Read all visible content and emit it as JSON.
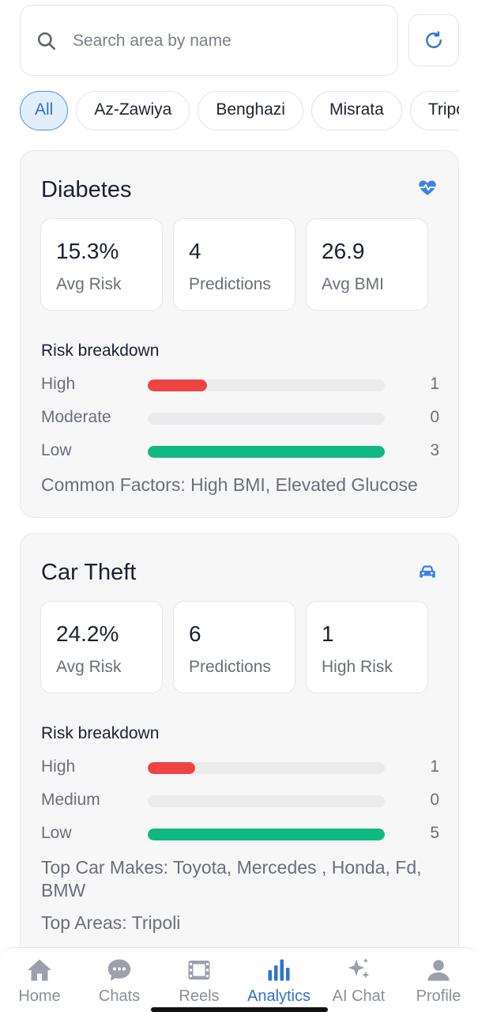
{
  "search": {
    "placeholder": "Search area by name",
    "value": ""
  },
  "chips": [
    "All",
    "Az-Zawiya",
    "Benghazi",
    "Misrata",
    "Tripoli"
  ],
  "cards": [
    {
      "title": "Diabetes",
      "icon": "heartbeat-icon",
      "stats": [
        {
          "value": "15.3%",
          "label": "Avg Risk"
        },
        {
          "value": "4",
          "label": "Predictions"
        },
        {
          "value": "26.9",
          "label": "Avg BMI"
        }
      ],
      "breakdown_label": "Risk breakdown",
      "breakdown": [
        {
          "name": "High",
          "count": "1",
          "fraction": 0.25,
          "color": "#ef4444"
        },
        {
          "name": "Moderate",
          "count": "0",
          "fraction": 0,
          "color": "#ef4444"
        },
        {
          "name": "Low",
          "count": "3",
          "fraction": 1.0,
          "color": "#10b981"
        }
      ],
      "footnotes": [
        "Common Factors: High BMI, Elevated Glucose"
      ]
    },
    {
      "title": "Car Theft",
      "icon": "car-icon",
      "stats": [
        {
          "value": "24.2%",
          "label": "Avg Risk"
        },
        {
          "value": "6",
          "label": "Predictions"
        },
        {
          "value": "1",
          "label": "High Risk"
        }
      ],
      "breakdown_label": "Risk breakdown",
      "breakdown": [
        {
          "name": "High",
          "count": "1",
          "fraction": 0.2,
          "color": "#ef4444"
        },
        {
          "name": "Medium",
          "count": "0",
          "fraction": 0,
          "color": "#ef4444"
        },
        {
          "name": "Low",
          "count": "5",
          "fraction": 1.0,
          "color": "#10b981"
        }
      ],
      "footnotes": [
        "Top Car Makes: Toyota, Mercedes , Honda, Fd, BMW",
        "Top Areas: Tripoli"
      ]
    }
  ],
  "nav": [
    {
      "label": "Home",
      "icon": "home-icon"
    },
    {
      "label": "Chats",
      "icon": "chat-bubble-icon"
    },
    {
      "label": "Reels",
      "icon": "film-icon"
    },
    {
      "label": "Analytics",
      "icon": "bar-chart-icon",
      "active": true
    },
    {
      "label": "AI Chat",
      "icon": "sparkles-icon"
    },
    {
      "label": "Profile",
      "icon": "person-icon"
    }
  ],
  "colors": {
    "accent": "#2f73d0",
    "high": "#ef4444",
    "low": "#10b981",
    "inactive": "#8a8f99"
  }
}
